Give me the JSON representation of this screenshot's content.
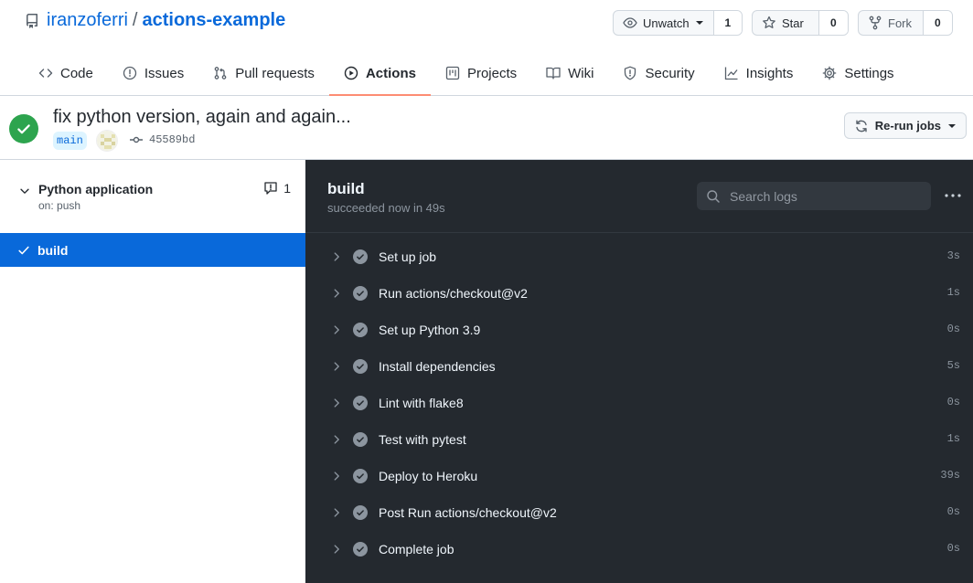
{
  "repo": {
    "owner": "iranzoferri",
    "separator": "/",
    "name": "actions-example"
  },
  "actions": {
    "unwatch": {
      "label": "Unwatch",
      "count": "1"
    },
    "star": {
      "label": "Star",
      "count": "0"
    },
    "fork": {
      "label": "Fork",
      "count": "0"
    }
  },
  "tabs": [
    {
      "label": "Code",
      "icon": "code-icon"
    },
    {
      "label": "Issues",
      "icon": "issue-icon"
    },
    {
      "label": "Pull requests",
      "icon": "pull-request-icon"
    },
    {
      "label": "Actions",
      "icon": "play-icon",
      "active": true
    },
    {
      "label": "Projects",
      "icon": "project-icon"
    },
    {
      "label": "Wiki",
      "icon": "book-icon"
    },
    {
      "label": "Security",
      "icon": "shield-icon"
    },
    {
      "label": "Insights",
      "icon": "graph-icon"
    },
    {
      "label": "Settings",
      "icon": "gear-icon"
    }
  ],
  "run": {
    "title": "fix python version, again and again...",
    "branch": "main",
    "commit": "45589bd",
    "rerun_label": "Re-run jobs",
    "status_color": "#2da44e"
  },
  "sidebar": {
    "workflow_name": "Python application",
    "trigger": "on: push",
    "comment_count": "1",
    "job_label": "build",
    "selected_color": "#0969da"
  },
  "job": {
    "title": "build",
    "subtitle": "succeeded now in 49s",
    "search_placeholder": "Search logs",
    "steps": [
      {
        "name": "Set up job",
        "duration": "3s"
      },
      {
        "name": "Run actions/checkout@v2",
        "duration": "1s"
      },
      {
        "name": "Set up Python 3.9",
        "duration": "0s"
      },
      {
        "name": "Install dependencies",
        "duration": "5s"
      },
      {
        "name": "Lint with flake8",
        "duration": "0s"
      },
      {
        "name": "Test with pytest",
        "duration": "1s"
      },
      {
        "name": "Deploy to Heroku",
        "duration": "39s"
      },
      {
        "name": "Post Run actions/checkout@v2",
        "duration": "0s"
      },
      {
        "name": "Complete job",
        "duration": "0s"
      }
    ]
  }
}
